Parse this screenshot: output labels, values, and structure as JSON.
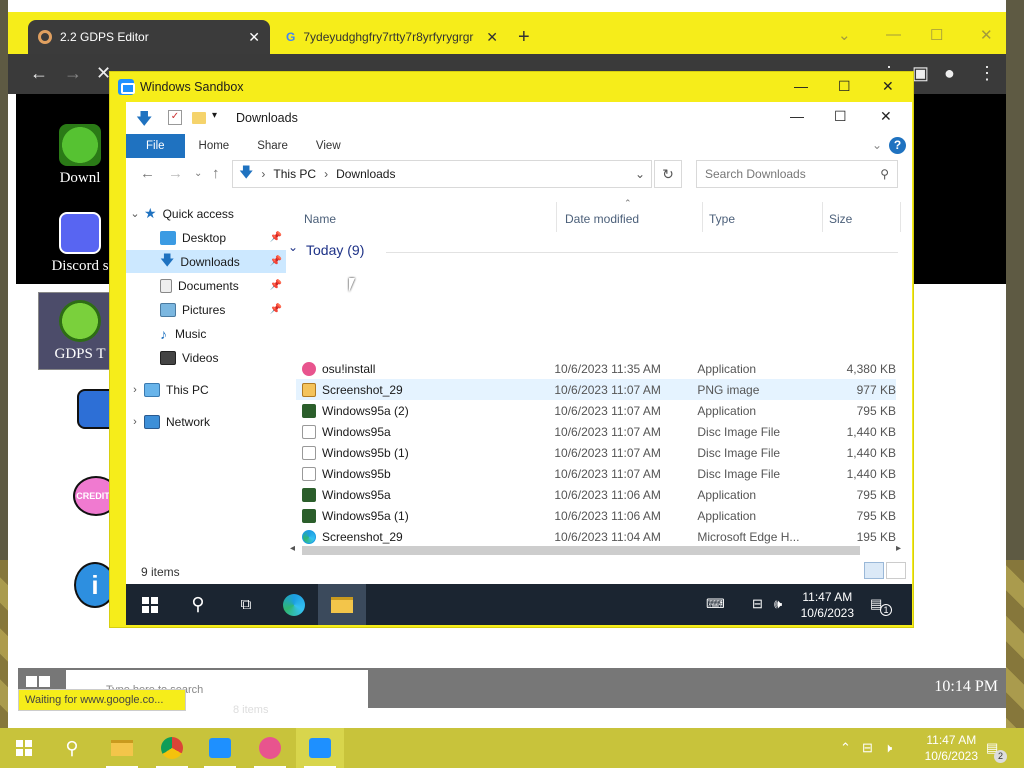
{
  "browser": {
    "tabs": [
      {
        "title": "2.2 GDPS Editor",
        "active": true
      },
      {
        "title": "7ydeyudghgfry7rtty7r8yrfyrygrgr",
        "active": false
      }
    ],
    "status_tip": "Waiting for www.google.co...",
    "page": {
      "menu": [
        "Downl",
        "Discord s",
        "GDPS T"
      ],
      "credits_label": "CREDITS",
      "search_placeholder": "Type here to search",
      "clock": "10:14 PM",
      "taskbar_count": "8 items"
    }
  },
  "sandbox": {
    "title": "Windows Sandbox",
    "explorer": {
      "title": "Downloads",
      "ribbon_tabs": [
        "File",
        "Home",
        "Share",
        "View"
      ],
      "help": "?",
      "breadcrumb": [
        "This PC",
        "Downloads"
      ],
      "search_placeholder": "Search Downloads",
      "nav": {
        "quick_access": "Quick access",
        "items": [
          "Desktop",
          "Downloads",
          "Documents",
          "Pictures",
          "Music",
          "Videos"
        ],
        "this_pc": "This PC",
        "network": "Network"
      },
      "columns": [
        "Name",
        "Date modified",
        "Type",
        "Size"
      ],
      "group": "Today (9)",
      "files": [
        {
          "name": "osu!install",
          "date": "10/6/2023 11:35 AM",
          "type": "Application",
          "size": "4,380 KB",
          "icon": "osu"
        },
        {
          "name": "Screenshot_29",
          "date": "10/6/2023 11:07 AM",
          "type": "PNG image",
          "size": "977 KB",
          "icon": "png"
        },
        {
          "name": "Windows95a (2)",
          "date": "10/6/2023 11:07 AM",
          "type": "Application",
          "size": "795 KB",
          "icon": "app"
        },
        {
          "name": "Windows95a",
          "date": "10/6/2023 11:07 AM",
          "type": "Disc Image File",
          "size": "1,440 KB",
          "icon": "disc"
        },
        {
          "name": "Windows95b (1)",
          "date": "10/6/2023 11:07 AM",
          "type": "Disc Image File",
          "size": "1,440 KB",
          "icon": "disc"
        },
        {
          "name": "Windows95b",
          "date": "10/6/2023 11:07 AM",
          "type": "Disc Image File",
          "size": "1,440 KB",
          "icon": "disc"
        },
        {
          "name": "Windows95a",
          "date": "10/6/2023 11:06 AM",
          "type": "Application",
          "size": "795 KB",
          "icon": "app"
        },
        {
          "name": "Windows95a (1)",
          "date": "10/6/2023 11:06 AM",
          "type": "Application",
          "size": "795 KB",
          "icon": "app"
        },
        {
          "name": "Screenshot_29",
          "date": "10/6/2023 11:04 AM",
          "type": "Microsoft Edge H...",
          "size": "195 KB",
          "icon": "edge"
        }
      ],
      "status": "9 items"
    },
    "taskbar": {
      "time": "11:47 AM",
      "date": "10/6/2023",
      "notifications": "1"
    }
  },
  "os_taskbar": {
    "time": "11:47 AM",
    "date": "10/6/2023",
    "notifications": "2"
  },
  "colors": {
    "accent": "#f6ed1a",
    "explorer_blue": "#1f72c0",
    "selected": "#cce8ff"
  }
}
